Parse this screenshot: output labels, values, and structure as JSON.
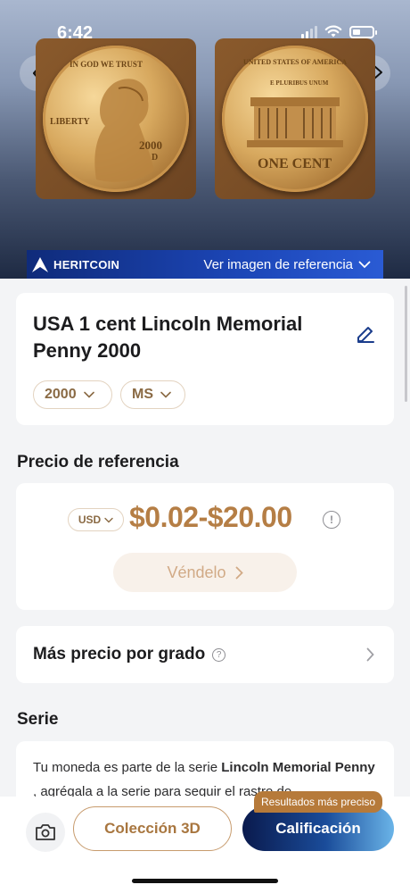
{
  "status_bar": {
    "time": "6:42"
  },
  "banner": {
    "brand": "HERITCOIN",
    "reference_link": "Ver imagen de referencia"
  },
  "coin_images": {
    "obverse_text": {
      "motto": "IN GOD WE TRUST",
      "liberty": "LIBERTY",
      "year": "2000",
      "mint": "D"
    },
    "reverse_text": {
      "top": "UNITED STATES OF AMERICA",
      "motto": "E PLURIBUS UNUM",
      "denomination": "ONE CENT"
    }
  },
  "coin": {
    "title": "USA 1 cent  Lincoln Memorial Penny 2000",
    "year_chip": "2000",
    "grade_chip": "MS"
  },
  "reference_price": {
    "section_title": "Precio de referencia",
    "currency": "USD",
    "range": "$0.02-$20.00",
    "sell_button": "Véndelo"
  },
  "grade_prices": {
    "label": "Más precio por grado"
  },
  "series": {
    "section_title": "Serie",
    "text_before": "Tu moneda es parte de la serie ",
    "series_name": "Lincoln Memorial Penny",
    "text_after": " , agrégala a la serie para seguir el rastro de"
  },
  "bottom_bar": {
    "collection_3d": "Colección 3D",
    "grading": "Calificación",
    "badge": "Resultados más preciso"
  },
  "colors": {
    "accent_gold": "#b57e45",
    "brand_blue": "#1c46b7"
  }
}
